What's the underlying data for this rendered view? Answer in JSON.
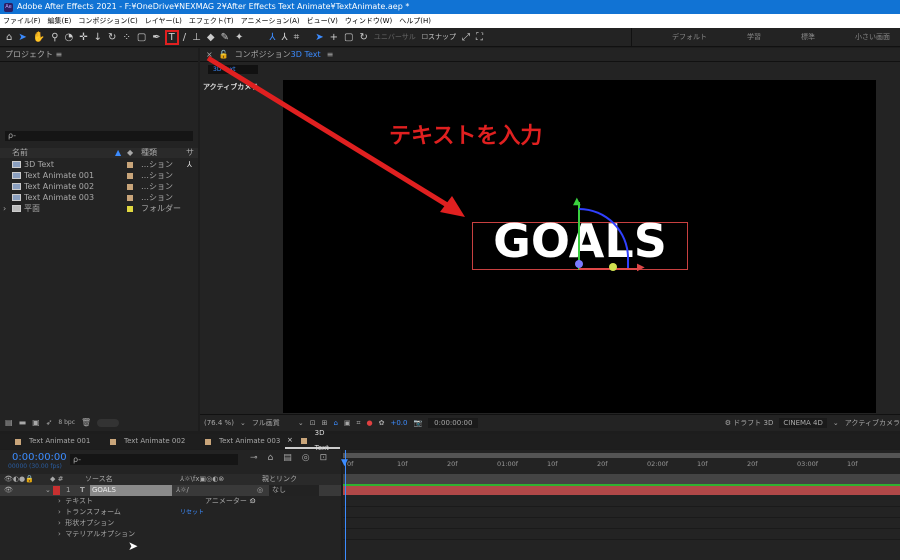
{
  "window": {
    "title": "Adobe After Effects 2021 - F:¥OneDrive¥NEXMAG 2¥After Effects Text Animate¥TextAnimate.aep *",
    "app_icon": "Ae"
  },
  "menu": [
    "ファイル(F)",
    "編集(E)",
    "コンポジション(C)",
    "レイヤー(L)",
    "エフェクト(T)",
    "アニメーション(A)",
    "ビュー(V)",
    "ウィンドウ(W)",
    "ヘルプ(H)"
  ],
  "toolbar": {
    "universal": "ユニバーサル",
    "snap": "スナップ",
    "workspaces": [
      "デフォルト",
      "学習",
      "標準",
      "小さい画面"
    ]
  },
  "project": {
    "title": "プロジェクト",
    "search_placeholder": "ρ-",
    "columns": [
      "名前",
      "種類",
      "サ"
    ],
    "items": [
      {
        "name": "3D Text",
        "type": "…ション"
      },
      {
        "name": "Text Animate 001",
        "type": "…ション"
      },
      {
        "name": "Text Animate 002",
        "type": "…ション"
      },
      {
        "name": "Text Animate 003",
        "type": "…ション"
      },
      {
        "name": "平面",
        "type": "フォルダー"
      }
    ],
    "bpc": "8 bpc"
  },
  "composition": {
    "title": "コンポジション",
    "comp_name": "3D Text",
    "subtab": "3D Text",
    "camera_label": "アクティブカメラ",
    "canvas_text": "GOALS",
    "annotation": "テキストを入力",
    "zoom": "(76.4 %)",
    "quality": "フル画質",
    "exposure": "+0.0",
    "timecode": "0:00:00:00",
    "draft3d": "ドラフト 3D",
    "renderer": "CINEMA 4D",
    "view": "アクティブカメラ"
  },
  "timeline": {
    "tabs": [
      "Text Animate 001",
      "Text Animate 002",
      "Text Animate 003",
      "3D Text"
    ],
    "time": "0:00:00:00",
    "frames": "00000 (30.00 fps)",
    "columns": {
      "source": "ソース名",
      "parent": "親とリンク"
    },
    "layer": {
      "num": "1",
      "name": "GOALS",
      "parent": "なし"
    },
    "props": [
      "テキスト",
      "トランスフォーム",
      "形状オプション",
      "マテリアルオプション"
    ],
    "animator": "アニメーター :",
    "reset": "リセット",
    "ruler": [
      "0f",
      "10f",
      "20f",
      "01:00f",
      "10f",
      "20f",
      "02:00f",
      "10f",
      "20f",
      "03:00f",
      "10f"
    ]
  },
  "colors": {
    "accent": "#3c8cff",
    "annotation": "#e02020",
    "layer_bar": "#b04848"
  }
}
